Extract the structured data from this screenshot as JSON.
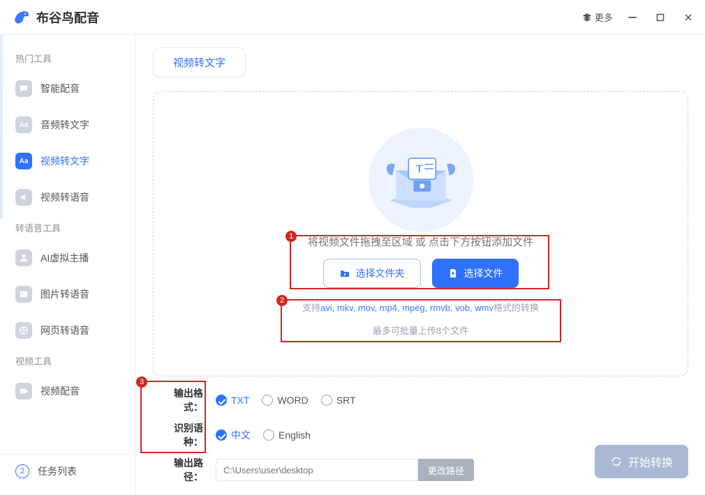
{
  "app": {
    "title": "布谷鸟配音",
    "more": "更多"
  },
  "sidebar": {
    "section1": "热门工具",
    "items1": [
      "智能配音",
      "音频转文字",
      "视频转文字",
      "视频转语音"
    ],
    "section2": "转语音工具",
    "items2": [
      "AI虚拟主播",
      "图片转语音",
      "网页转语音"
    ],
    "section3": "视频工具",
    "items3": [
      "视频配音"
    ],
    "task_label": "任务列表",
    "task_count": "2"
  },
  "content": {
    "tab": "视频转文字",
    "dz_text": "将视频文件拖拽至区域 或 点击下方按钮添加文件",
    "btn_folder": "选择文件夹",
    "btn_file": "选择文件",
    "support_prefix": "支持",
    "support_formats": "avi, mkv, mov, mp4, mpeg, rmvb, vob, wmv",
    "support_suffix": "格式的转换",
    "limit": "最多可批量上传8个文件"
  },
  "settings": {
    "fmt_label": "输出格式：",
    "fmt_opts": [
      "TXT",
      "WORD",
      "SRT"
    ],
    "lang_label": "识别语种：",
    "lang_opts": [
      "中文",
      "English"
    ],
    "path_label": "输出路径：",
    "path_placeholder": "C:\\Users\\user\\desktop",
    "path_btn": "更改路径",
    "start": "开始转换"
  },
  "badges": {
    "b1": "1",
    "b2": "2",
    "b3": "3"
  }
}
